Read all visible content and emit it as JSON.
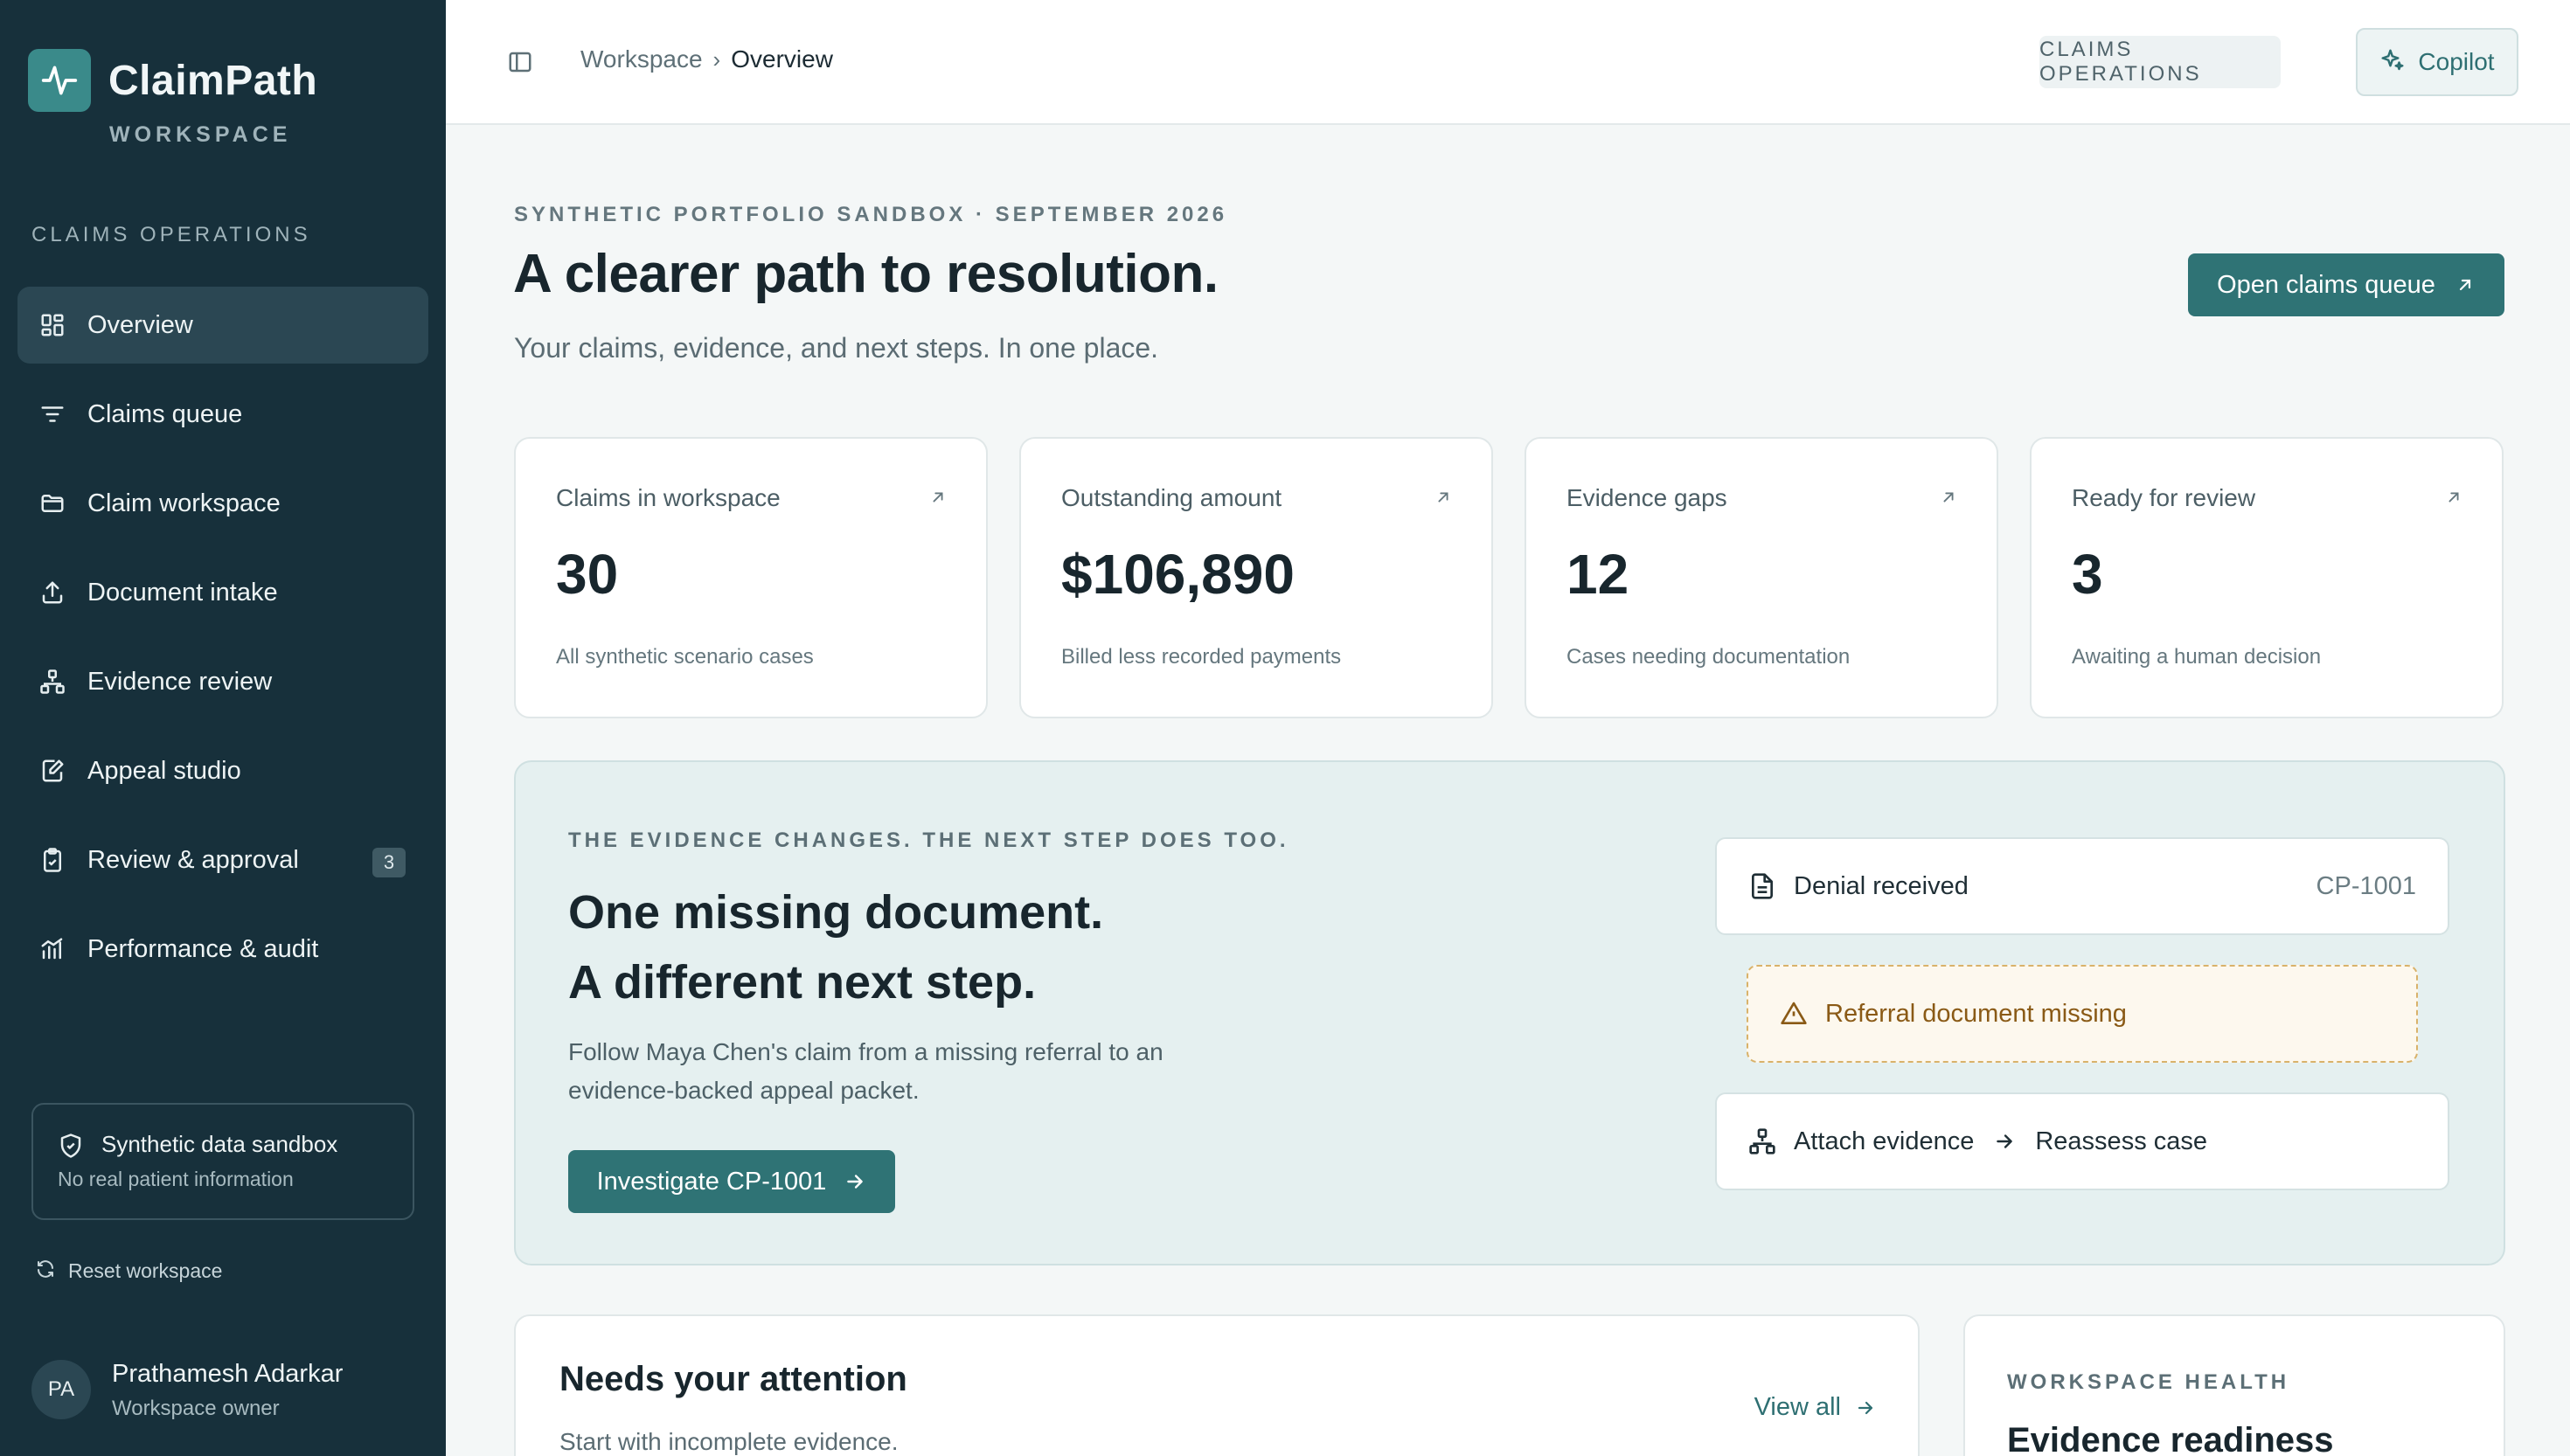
{
  "sidebar": {
    "brand_name": "ClaimPath",
    "brand_sub": "WORKSPACE",
    "section_label": "CLAIMS OPERATIONS",
    "items": [
      {
        "label": "Overview",
        "icon": "grid-icon"
      },
      {
        "label": "Claims queue",
        "icon": "filter-lines-icon"
      },
      {
        "label": "Claim workspace",
        "icon": "folder-icon"
      },
      {
        "label": "Document intake",
        "icon": "upload-icon"
      },
      {
        "label": "Evidence review",
        "icon": "network-icon"
      },
      {
        "label": "Appeal studio",
        "icon": "edit-document-icon"
      },
      {
        "label": "Review & approval",
        "icon": "clipboard-check-icon",
        "badge": "3"
      },
      {
        "label": "Performance & audit",
        "icon": "chart-icon"
      }
    ],
    "sandbox_title": "Synthetic data sandbox",
    "sandbox_sub": "No real patient information",
    "reset_label": "Reset workspace",
    "user_initials": "PA",
    "user_name": "Prathamesh Adarkar",
    "user_role": "Workspace owner"
  },
  "header": {
    "crumb_root": "Workspace",
    "crumb_current": "Overview",
    "ops_chip": "CLAIMS OPERATIONS",
    "copilot_label": "Copilot"
  },
  "hero": {
    "eyebrow": "SYNTHETIC PORTFOLIO SANDBOX · SEPTEMBER 2026",
    "title": "A clearer path to resolution.",
    "subtitle": "Your claims, evidence, and next steps. In one place.",
    "cta_label": "Open claims queue"
  },
  "stats": [
    {
      "label": "Claims in workspace",
      "value": "30",
      "note": "All synthetic scenario cases"
    },
    {
      "label": "Outstanding amount",
      "value": "$106,890",
      "note": "Billed less recorded payments"
    },
    {
      "label": "Evidence gaps",
      "value": "12",
      "note": "Cases needing documentation"
    },
    {
      "label": "Ready for review",
      "value": "3",
      "note": "Awaiting a human decision"
    }
  ],
  "panel": {
    "eyebrow": "THE EVIDENCE CHANGES. THE NEXT STEP DOES TOO.",
    "title_line1": "One missing document.",
    "title_line2": "A different next step.",
    "description": "Follow Maya Chen's claim from a missing referral to an evidence-backed appeal packet.",
    "button_label": "Investigate CP-1001",
    "flow_denial": "Denial received",
    "flow_code": "CP-1001",
    "flow_warning": "Referral document missing",
    "flow_attach": "Attach evidence",
    "flow_reassess": "Reassess case"
  },
  "attention": {
    "title": "Needs your attention",
    "subtitle": "Start with incomplete evidence.",
    "view_all": "View all"
  },
  "health": {
    "eyebrow": "WORKSPACE HEALTH",
    "title": "Evidence readiness"
  },
  "colors": {
    "sidebar_bg": "#17303b",
    "accent": "#2f7375",
    "warning": "#d9b26a"
  }
}
